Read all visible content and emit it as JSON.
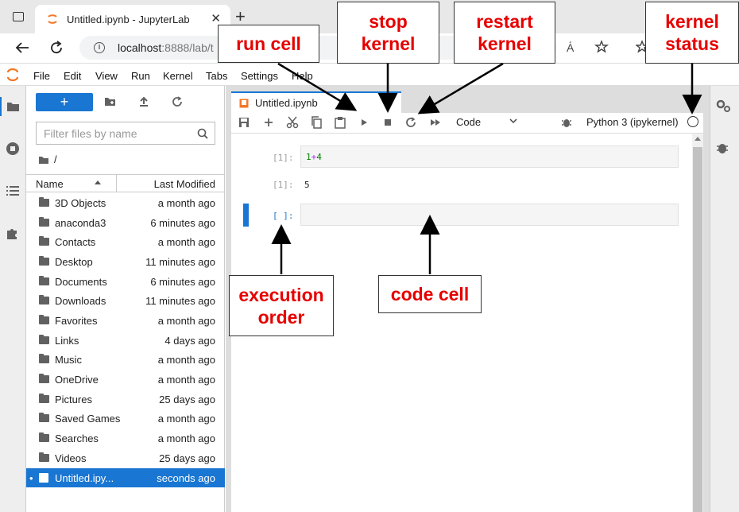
{
  "browser": {
    "tab_title": "Untitled.ipynb - JupyterLab",
    "url_host": "localhost",
    "url_rest": ":8888/lab/t",
    "close_glyph": "✕",
    "new_tab_glyph": "+"
  },
  "menu": [
    "File",
    "Edit",
    "View",
    "Run",
    "Kernel",
    "Tabs",
    "Settings",
    "Help"
  ],
  "filebrowser": {
    "filter_placeholder": "Filter files by name",
    "breadcrumb": "/",
    "col_name": "Name",
    "col_modified": "Last Modified",
    "files": [
      {
        "name": "3D Objects",
        "modified": "a month ago"
      },
      {
        "name": "anaconda3",
        "modified": "6 minutes ago"
      },
      {
        "name": "Contacts",
        "modified": "a month ago"
      },
      {
        "name": "Desktop",
        "modified": "11 minutes ago"
      },
      {
        "name": "Documents",
        "modified": "6 minutes ago"
      },
      {
        "name": "Downloads",
        "modified": "11 minutes ago"
      },
      {
        "name": "Favorites",
        "modified": "a month ago"
      },
      {
        "name": "Links",
        "modified": "4 days ago"
      },
      {
        "name": "Music",
        "modified": "a month ago"
      },
      {
        "name": "OneDrive",
        "modified": "a month ago"
      },
      {
        "name": "Pictures",
        "modified": "25 days ago"
      },
      {
        "name": "Saved Games",
        "modified": "a month ago"
      },
      {
        "name": "Searches",
        "modified": "a month ago"
      },
      {
        "name": "Videos",
        "modified": "25 days ago"
      },
      {
        "name": "Untitled.ipy...",
        "modified": "seconds ago",
        "selected": true
      }
    ]
  },
  "notebook": {
    "tab_title": "Untitled.ipynb",
    "cell_type": "Code",
    "kernel_name": "Python 3 (ipykernel)",
    "cells": {
      "in1_prompt": "[1]:",
      "in1_code_a": "1",
      "in1_code_op": "+",
      "in1_code_b": "4",
      "out1_prompt": "[1]:",
      "out1_value": "5",
      "in2_prompt": "[ ]:"
    }
  },
  "annotations": {
    "run_cell": "run cell",
    "stop_kernel_1": "stop",
    "stop_kernel_2": "kernel",
    "restart_kernel_1": "restart",
    "restart_kernel_2": "kernel",
    "kernel_status_1": "kernel",
    "kernel_status_2": "status",
    "execution_order_1": "execution",
    "execution_order_2": "order",
    "code_cell": "code cell"
  },
  "colors": {
    "accent": "#1976d2",
    "annotation_text": "#e60000"
  }
}
